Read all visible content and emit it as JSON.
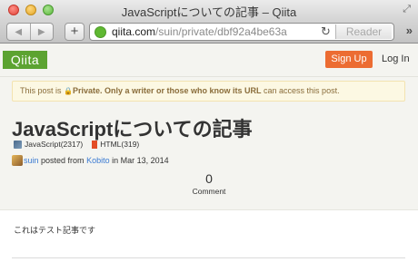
{
  "window": {
    "title": "JavaScriptについての記事 – Qiita"
  },
  "toolbar": {
    "back_icon": "back-arrow",
    "forward_icon": "forward-arrow",
    "plus_label": "+",
    "url_domain": "qiita.com",
    "url_path": "/suin/private/dbf92a4be63a",
    "reader_label": "Reader"
  },
  "site_header": {
    "logo_text": "Qiita",
    "signup_label": "Sign Up",
    "login_label": "Log In",
    "colors": {
      "logo": "#5ca331",
      "signup": "#ec6c32"
    }
  },
  "notice": {
    "prefix": "This post is ",
    "bold": "Private. Only a writer or those who know its URL",
    "suffix": " can access this post."
  },
  "article": {
    "title": "JavaScriptについての記事",
    "tags": [
      {
        "name": "JavaScript",
        "count": "(2317)"
      },
      {
        "name": "HTML",
        "count": "(319)"
      }
    ],
    "author": "suin",
    "posted_from_label": "posted from",
    "posted_via": "Kobito",
    "date_prefix": "in",
    "date": "Mar 13, 2014",
    "comment_count": "0",
    "comment_label": "Comment",
    "body_text": "これはテスト記事です"
  }
}
